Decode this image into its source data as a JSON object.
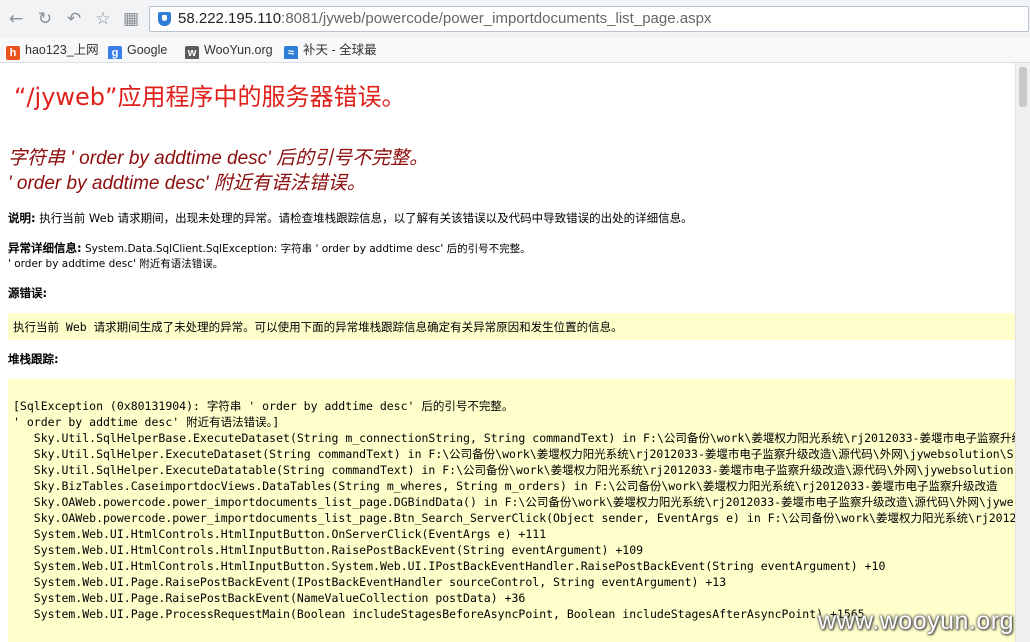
{
  "browser": {
    "url_host": "58.222.195.110",
    "url_rest": ":8081/jyweb/powercode/power_importdocuments_list_page.aspx",
    "bookmarks": [
      {
        "label": "hao123_上网",
        "icon": "hao123-icon"
      },
      {
        "label": "Google",
        "icon": "google-icon"
      },
      {
        "label": "WooYun.org",
        "icon": "wooyun-icon"
      },
      {
        "label": "补天 - 全球最",
        "icon": "butian-icon"
      }
    ]
  },
  "error": {
    "title": "“/jyweb”应用程序中的服务器错误。",
    "message_line1": "字符串 ' order by addtime desc' 后的引号不完整。",
    "message_line2": "' order by addtime desc' 附近有语法错误。",
    "description_label": "说明:",
    "description_text": " 执行当前 Web 请求期间，出现未处理的异常。请检查堆栈跟踪信息，以了解有关该错误以及代码中导致错误的出处的详细信息。",
    "exception_label": "异常详细信息:",
    "exception_text": " System.Data.SqlClient.SqlException: 字符串 ' order by addtime desc' 后的引号不完整。",
    "exception_text2": "' order by addtime desc' 附近有语法错误。",
    "source_label": "源错误:",
    "source_text": "执行当前 Web 请求期间生成了未处理的异常。可以使用下面的异常堆栈跟踪信息确定有关异常原因和发生位置的信息。",
    "stack_label": "堆栈跟踪:",
    "stack_lines": [
      "[SqlException (0x80131904): 字符串 ' order by addtime desc' 后的引号不完整。",
      "' order by addtime desc' 附近有语法错误。]",
      "   Sky.Util.SqlHelperBase.ExecuteDataset(String m_connectionString, String commandText) in F:\\公司备份\\work\\姜堰权力阳光系统\\rj2012033-姜堰市电子监察升级",
      "   Sky.Util.SqlHelper.ExecuteDataset(String commandText) in F:\\公司备份\\work\\姜堰权力阳光系统\\rj2012033-姜堰市电子监察升级改造\\源代码\\外网\\jywebsolution\\S",
      "   Sky.Util.SqlHelper.ExecuteDatatable(String commandText) in F:\\公司备份\\work\\姜堰权力阳光系统\\rj2012033-姜堰市电子监察升级改造\\源代码\\外网\\jywebsolution",
      "   Sky.BizTables.CaseimportdocViews.DataTables(String m_wheres, String m_orders) in F:\\公司备份\\work\\姜堰权力阳光系统\\rj2012033-姜堰市电子监察升级改造",
      "   Sky.OAWeb.powercode.power_importdocuments_list_page.DGBindData() in F:\\公司备份\\work\\姜堰权力阳光系统\\rj2012033-姜堰市电子监察升级改造\\源代码\\外网\\jywe",
      "   Sky.OAWeb.powercode.power_importdocuments_list_page.Btn_Search_ServerClick(Object sender, EventArgs e) in F:\\公司备份\\work\\姜堰权力阳光系统\\rj2012",
      "   System.Web.UI.HtmlControls.HtmlInputButton.OnServerClick(EventArgs e) +111",
      "   System.Web.UI.HtmlControls.HtmlInputButton.RaisePostBackEvent(String eventArgument) +109",
      "   System.Web.UI.HtmlControls.HtmlInputButton.System.Web.UI.IPostBackEventHandler.RaisePostBackEvent(String eventArgument) +10",
      "   System.Web.UI.Page.RaisePostBackEvent(IPostBackEventHandler sourceControl, String eventArgument) +13",
      "   System.Web.UI.Page.RaisePostBackEvent(NameValueCollection postData) +36",
      "   System.Web.UI.Page.ProcessRequestMain(Boolean includeStagesBeforeAsyncPoint, Boolean includeStagesAfterAsyncPoint) +1565"
    ]
  },
  "watermark": "www.wooyun.org",
  "colors": {
    "title": "#e0201a",
    "message": "#8b0d0d",
    "code_box": "#ffffcc"
  }
}
